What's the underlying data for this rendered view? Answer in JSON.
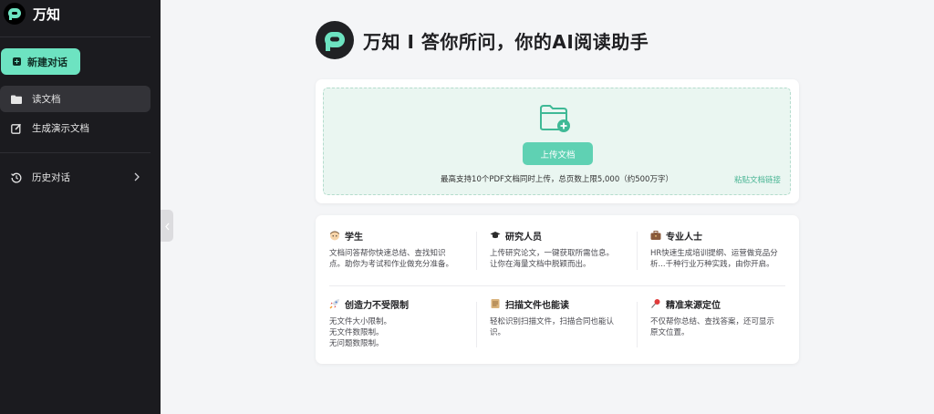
{
  "brand": {
    "name": "万知"
  },
  "sidebar": {
    "new_chat": "新建对话",
    "items": [
      {
        "label": "读文档"
      },
      {
        "label": "生成演示文档"
      }
    ],
    "history": "历史对话"
  },
  "hero": {
    "title": "万知 I 答你所问，你的AI阅读助手"
  },
  "upload": {
    "button": "上传文档",
    "hint": "最高支持10个PDF文档同时上传，总页数上限5,000（约500万字）",
    "paste_link": "粘贴文档链接"
  },
  "features": [
    {
      "icon": "student-icon",
      "title": "学生",
      "desc": "文档问答帮你快速总结、查找知识\n点。助你为考试和作业做充分准备。"
    },
    {
      "icon": "graduation-cap-icon",
      "title": "研究人员",
      "desc": "上传研究论文，一键获取所需信息。\n让你在海量文档中脱颖而出。"
    },
    {
      "icon": "briefcase-icon",
      "title": "专业人士",
      "desc": "HR快速生成培训提纲、运营做竞品分\n析...千种行业万种实践，由你开启。"
    },
    {
      "icon": "rocket-icon",
      "title": "创造力不受限制",
      "desc": "无文件大小限制。\n无文件数限制。\n无问题数限制。"
    },
    {
      "icon": "scroll-icon",
      "title": "扫描文件也能读",
      "desc": "轻松识别扫描文件，扫描合同也能认\n识。"
    },
    {
      "icon": "pin-icon",
      "title": "精准来源定位",
      "desc": "不仅帮你总结、查找答案，还可显示\n原文位置。"
    }
  ],
  "colors": {
    "accent": "#5fd1b3",
    "sidebar_bg": "#1b1b1f",
    "link": "#49b594"
  }
}
